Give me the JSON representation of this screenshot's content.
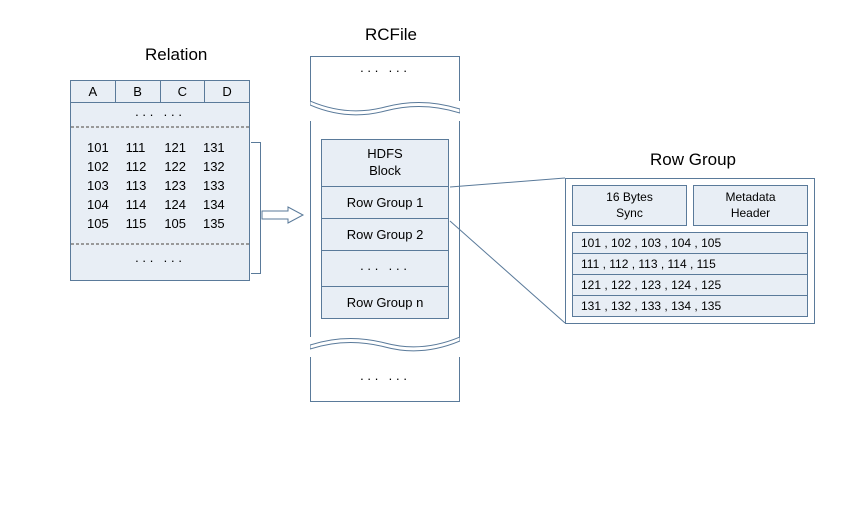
{
  "titles": {
    "relation": "Relation",
    "rcfile": "RCFile",
    "rowgroup": "Row Group"
  },
  "relation": {
    "columns": [
      "A",
      "B",
      "C",
      "D"
    ],
    "ellipsis": "···  ···",
    "rows": [
      [
        "101",
        "111",
        "121",
        "131"
      ],
      [
        "102",
        "112",
        "122",
        "132"
      ],
      [
        "103",
        "113",
        "123",
        "133"
      ],
      [
        "104",
        "114",
        "124",
        "134"
      ],
      [
        "105",
        "115",
        "105",
        "135"
      ]
    ]
  },
  "rcfile": {
    "top_ellipsis": "···  ···",
    "hdfs_header": "HDFS\nBlock",
    "row_group_1": "Row Group 1",
    "row_group_2": "Row Group 2",
    "middle_ellipsis": "···  ···",
    "row_group_n": "Row Group n",
    "bottom_ellipsis": "···  ···"
  },
  "rowgroup": {
    "sync": "16 Bytes\nSync",
    "metadata": "Metadata\nHeader",
    "data": [
      "101 , 102 , 103 , 104 , 105",
      "111 , 112 , 113 , 114 , 115",
      "121 , 122 , 123 , 124 , 125",
      "131 , 132 , 133 , 134 , 135"
    ]
  },
  "chart_data": {
    "type": "diagram",
    "description": "RCFile storage format showing how a relation splits into row groups stored in HDFS blocks, with each row group containing columnar data",
    "relation_columns": [
      "A",
      "B",
      "C",
      "D"
    ],
    "relation_sample_rows": [
      {
        "A": 101,
        "B": 111,
        "C": 121,
        "D": 131
      },
      {
        "A": 102,
        "B": 112,
        "C": 122,
        "D": 132
      },
      {
        "A": 103,
        "B": 113,
        "C": 123,
        "D": 133
      },
      {
        "A": 104,
        "B": 114,
        "C": 124,
        "D": 134
      },
      {
        "A": 105,
        "B": 115,
        "C": 105,
        "D": 135
      }
    ],
    "rowgroup_structure": {
      "sync_bytes": 16,
      "metadata_header": true,
      "column_chunks": [
        [
          101,
          102,
          103,
          104,
          105
        ],
        [
          111,
          112,
          113,
          114,
          115
        ],
        [
          121,
          122,
          123,
          124,
          125
        ],
        [
          131,
          132,
          133,
          134,
          135
        ]
      ]
    }
  }
}
